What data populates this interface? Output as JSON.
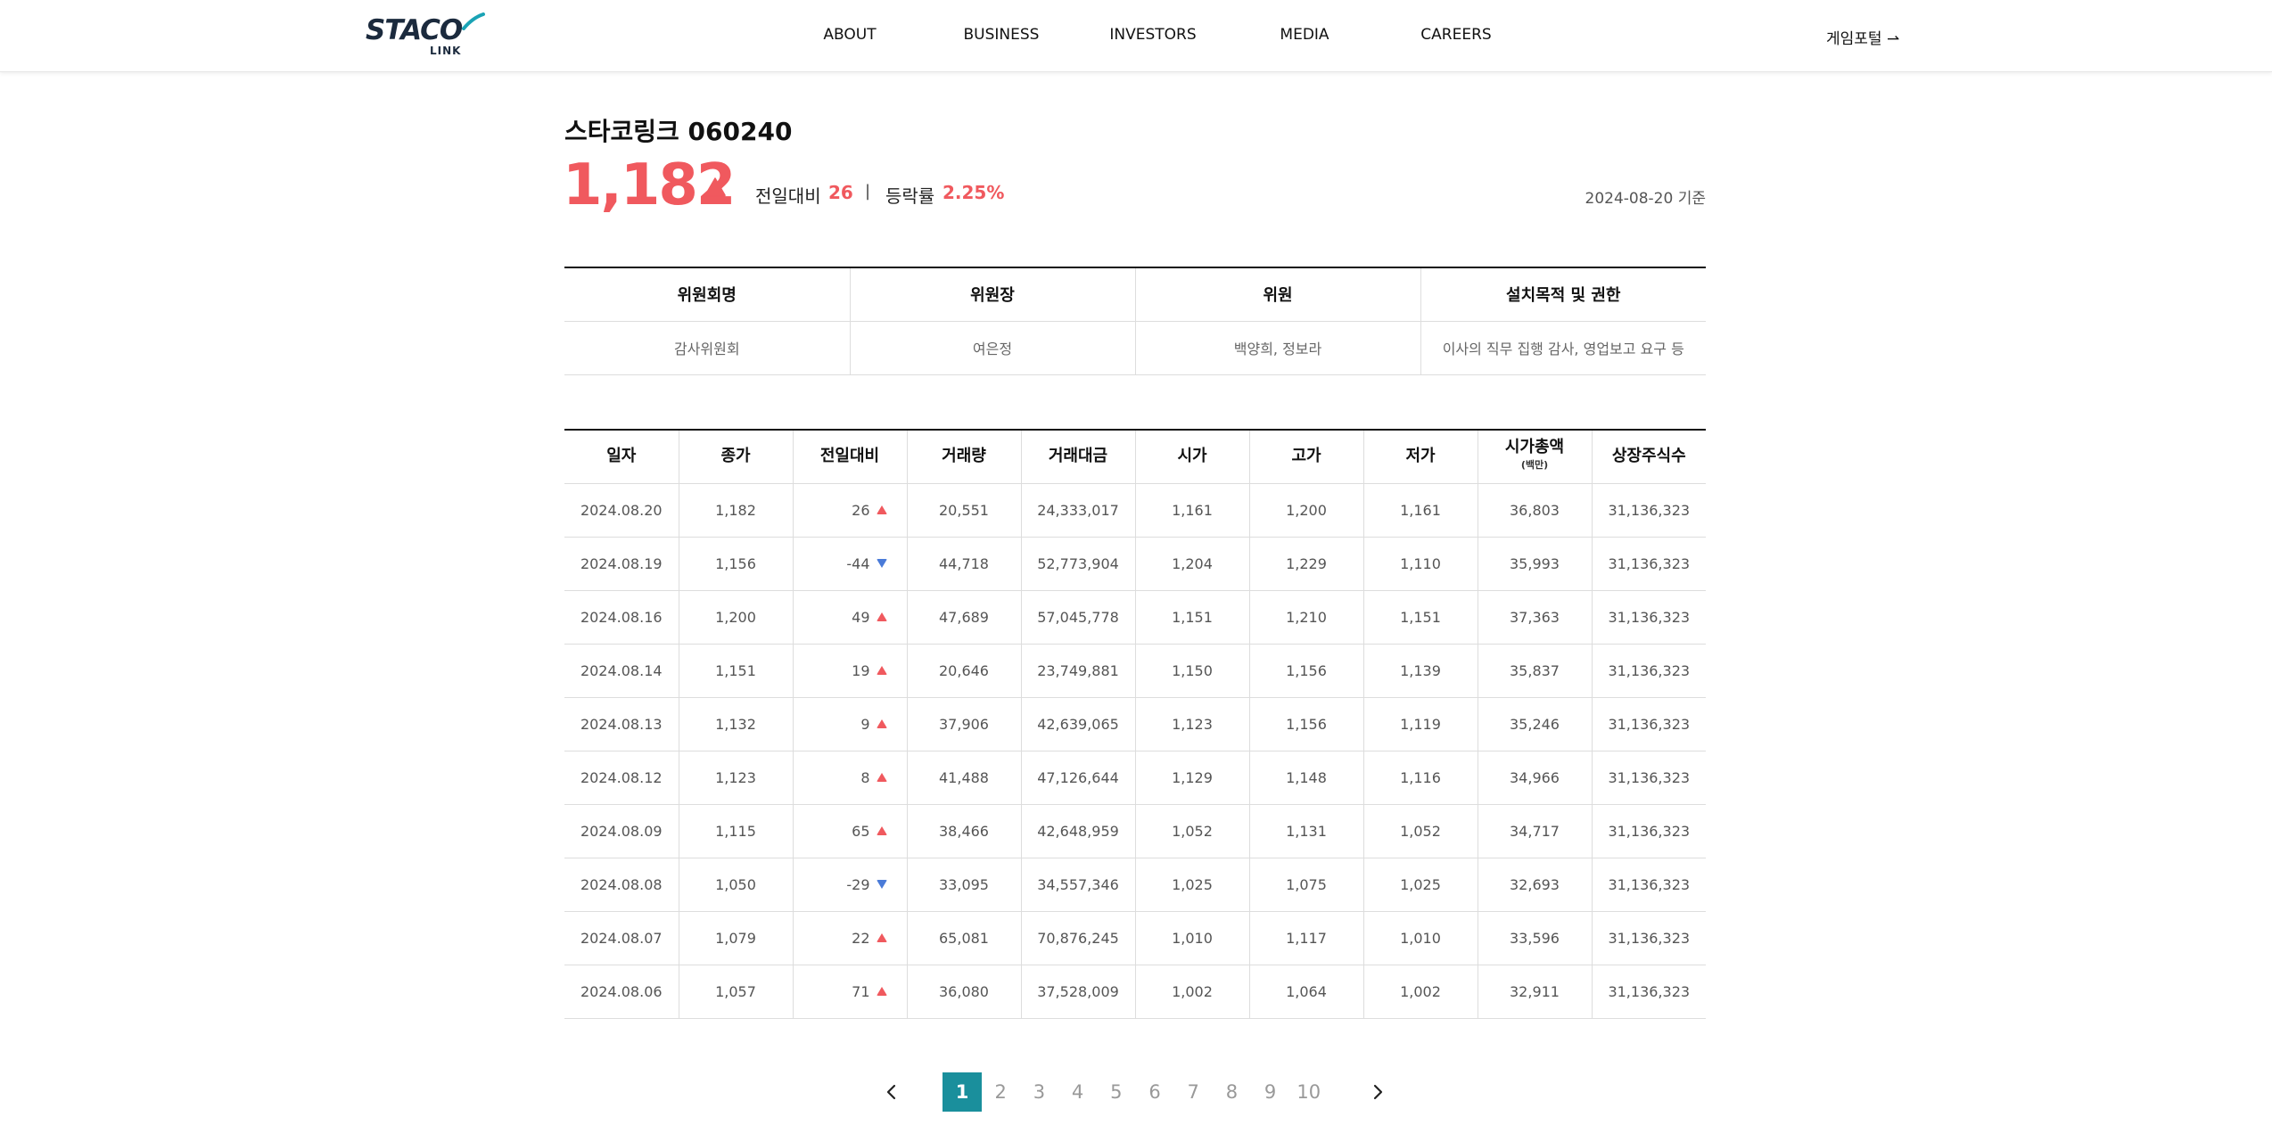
{
  "header": {
    "logo": "STACO LINK",
    "nav": [
      "ABOUT",
      "BUSINESS",
      "INVESTORS",
      "MEDIA",
      "CAREERS"
    ],
    "portal_link": "게임포털 ⇀"
  },
  "stock": {
    "name": "스타코링크 060240",
    "price": "1,182",
    "change_label": "전일대비",
    "change_value": "26",
    "separator": "|",
    "rate_label": "등락률",
    "rate_value": "2.25%",
    "as_of": "2024-08-20 기준",
    "direction": "up",
    "up_color": "#f0595e",
    "down_color": "#4a7bd8"
  },
  "committee": {
    "headers": [
      "위원회명",
      "위원장",
      "위원",
      "설치목적 및 권한"
    ],
    "row": [
      "감사위원회",
      "여은정",
      "백양희, 정보라",
      "이사의 직무 집행 감사, 영업보고 요구 등"
    ]
  },
  "prices": {
    "headers": [
      "일자",
      "종가",
      "전일대비",
      "거래량",
      "거래대금",
      "시가",
      "고가",
      "저가",
      "시가총액",
      "상장주식수"
    ],
    "market_cap_unit": "(백만)",
    "rows": [
      {
        "date": "2024.08.20",
        "close": "1,182",
        "change": "26",
        "dir": "up",
        "volume": "20,551",
        "amount": "24,333,017",
        "open": "1,161",
        "high": "1,200",
        "low": "1,161",
        "cap": "36,803",
        "shares": "31,136,323"
      },
      {
        "date": "2024.08.19",
        "close": "1,156",
        "change": "-44",
        "dir": "down",
        "volume": "44,718",
        "amount": "52,773,904",
        "open": "1,204",
        "high": "1,229",
        "low": "1,110",
        "cap": "35,993",
        "shares": "31,136,323"
      },
      {
        "date": "2024.08.16",
        "close": "1,200",
        "change": "49",
        "dir": "up",
        "volume": "47,689",
        "amount": "57,045,778",
        "open": "1,151",
        "high": "1,210",
        "low": "1,151",
        "cap": "37,363",
        "shares": "31,136,323"
      },
      {
        "date": "2024.08.14",
        "close": "1,151",
        "change": "19",
        "dir": "up",
        "volume": "20,646",
        "amount": "23,749,881",
        "open": "1,150",
        "high": "1,156",
        "low": "1,139",
        "cap": "35,837",
        "shares": "31,136,323"
      },
      {
        "date": "2024.08.13",
        "close": "1,132",
        "change": "9",
        "dir": "up",
        "volume": "37,906",
        "amount": "42,639,065",
        "open": "1,123",
        "high": "1,156",
        "low": "1,119",
        "cap": "35,246",
        "shares": "31,136,323"
      },
      {
        "date": "2024.08.12",
        "close": "1,123",
        "change": "8",
        "dir": "up",
        "volume": "41,488",
        "amount": "47,126,644",
        "open": "1,129",
        "high": "1,148",
        "low": "1,116",
        "cap": "34,966",
        "shares": "31,136,323"
      },
      {
        "date": "2024.08.09",
        "close": "1,115",
        "change": "65",
        "dir": "up",
        "volume": "38,466",
        "amount": "42,648,959",
        "open": "1,052",
        "high": "1,131",
        "low": "1,052",
        "cap": "34,717",
        "shares": "31,136,323"
      },
      {
        "date": "2024.08.08",
        "close": "1,050",
        "change": "-29",
        "dir": "down",
        "volume": "33,095",
        "amount": "34,557,346",
        "open": "1,025",
        "high": "1,075",
        "low": "1,025",
        "cap": "32,693",
        "shares": "31,136,323"
      },
      {
        "date": "2024.08.07",
        "close": "1,079",
        "change": "22",
        "dir": "up",
        "volume": "65,081",
        "amount": "70,876,245",
        "open": "1,010",
        "high": "1,117",
        "low": "1,010",
        "cap": "33,596",
        "shares": "31,136,323"
      },
      {
        "date": "2024.08.06",
        "close": "1,057",
        "change": "71",
        "dir": "up",
        "volume": "36,080",
        "amount": "37,528,009",
        "open": "1,002",
        "high": "1,064",
        "low": "1,002",
        "cap": "32,911",
        "shares": "31,136,323"
      }
    ]
  },
  "pagination": {
    "pages": [
      "1",
      "2",
      "3",
      "4",
      "5",
      "6",
      "7",
      "8",
      "9",
      "10"
    ],
    "current": "1",
    "active_color": "#1a8f9c"
  }
}
